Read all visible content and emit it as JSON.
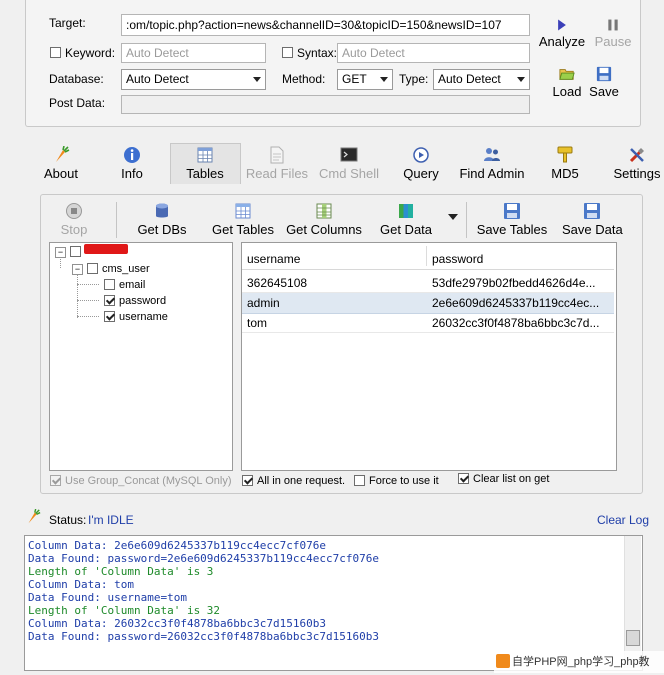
{
  "request": {
    "target_label": "Target:",
    "target_value": ":om/topic.php?action=news&channelID=30&topicID=150&newsID=107",
    "keyword_label": "Keyword:",
    "keyword_placeholder": "Auto Detect",
    "syntax_label": "Syntax:",
    "syntax_placeholder": "Auto Detect",
    "database_label": "Database:",
    "database_value": "Auto Detect",
    "method_label": "Method:",
    "method_value": "GET",
    "type_label": "Type:",
    "type_value": "Auto Detect",
    "postdata_label": "Post Data:",
    "postdata_value": ""
  },
  "side_buttons": {
    "analyze": "Analyze",
    "pause": "Pause",
    "load": "Load",
    "save": "Save"
  },
  "main_tabs": [
    {
      "label": "About",
      "icon": "carrot-icon"
    },
    {
      "label": "Info",
      "icon": "info-icon"
    },
    {
      "label": "Tables",
      "icon": "table-icon"
    },
    {
      "label": "Read Files",
      "icon": "file-icon"
    },
    {
      "label": "Cmd Shell",
      "icon": "terminal-icon"
    },
    {
      "label": "Query",
      "icon": "query-icon"
    },
    {
      "label": "Find Admin",
      "icon": "users-icon"
    },
    {
      "label": "MD5",
      "icon": "key-icon"
    },
    {
      "label": "Settings",
      "icon": "tools-icon"
    }
  ],
  "toolbar": {
    "stop": "Stop",
    "get_dbs": "Get DBs",
    "get_tables": "Get Tables",
    "get_columns": "Get Columns",
    "get_data": "Get Data",
    "save_tables": "Save Tables",
    "save_data": "Save Data"
  },
  "tree": {
    "table": "cms_user",
    "columns": [
      {
        "name": "email",
        "checked": false
      },
      {
        "name": "password",
        "checked": true
      },
      {
        "name": "username",
        "checked": true
      }
    ]
  },
  "grid": {
    "headers": [
      "username",
      "password"
    ],
    "rows": [
      [
        "362645108",
        "53dfe2979b02fbedd4626d4e..."
      ],
      [
        "admin",
        "2e6e609d6245337b119cc4ec..."
      ],
      [
        "tom",
        "26032cc3f0f4878ba6bbc3c7d..."
      ]
    ]
  },
  "options": {
    "group_concat": "Use Group_Concat (MySQL Only)",
    "all_in_one": "All in one request.",
    "force": "Force to use it",
    "clear_list": "Clear list on get"
  },
  "status": {
    "label": "Status:",
    "value": "I'm IDLE",
    "clear_log": "Clear Log"
  },
  "log": [
    {
      "text": "Column Data: 2e6e609d6245337b119cc4ecc7cf076e",
      "color": "blue"
    },
    {
      "text": "Data Found: password=2e6e609d6245337b119cc4ecc7cf076e",
      "color": "blue"
    },
    {
      "text": "Length of 'Column Data' is 3",
      "color": "green"
    },
    {
      "text": "Column Data: tom",
      "color": "blue"
    },
    {
      "text": "Data Found: username=tom",
      "color": "blue"
    },
    {
      "text": "Length of 'Column Data' is 32",
      "color": "green"
    },
    {
      "text": "Column Data: 26032cc3f0f4878ba6bbc3c7d15160b3",
      "color": "blue"
    },
    {
      "text": "Data Found: password=26032cc3f0f4878ba6bbc3c7d15160b3",
      "color": "blue"
    }
  ],
  "watermark": "自学PHP网_php学习_php教"
}
